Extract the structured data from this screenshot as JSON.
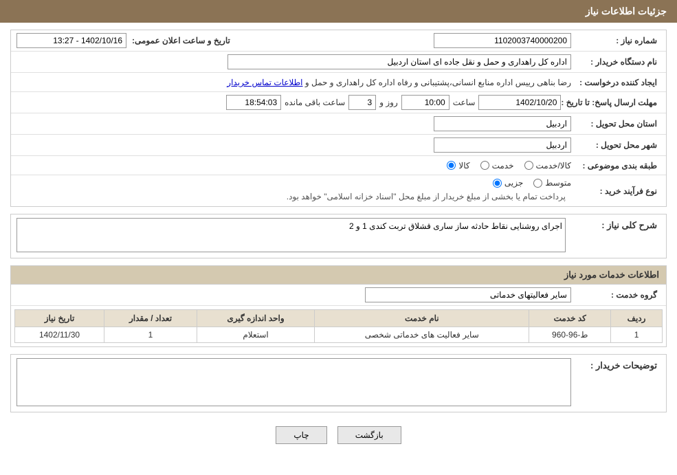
{
  "header": {
    "title": "جزئیات اطلاعات نیاز"
  },
  "fields": {
    "shomareNiaz_label": "شماره نیاز :",
    "shomareNiaz_value": "1102003740000200",
    "namDastgah_label": "نام دستگاه خریدار :",
    "namDastgah_value": "اداره کل راهداری و حمل و نقل جاده ای استان اردبیل",
    "ijadKonande_label": "ایجاد کننده درخواست :",
    "ijadKonande_value": "رضا بناهی رییس اداره منابع انسانی،پشتیبانی و رفاه اداره کل راهداری و حمل و",
    "ijadKonande_link": "اطلاعات تماس خریدار",
    "mohlat_label": "مهلت ارسال پاسخ: تا تاریخ :",
    "tarikh_value": "1402/10/20",
    "saat_label": "ساعت",
    "saat_value": "10:00",
    "rooz_label": "روز و",
    "rooz_value": "3",
    "baghimande_label": "ساعت باقی مانده",
    "baghimande_value": "18:54:03",
    "tarikh_sabt_label": "تاریخ و ساعت اعلان عمومی:",
    "tarikh_sabt_value": "1402/10/16 - 13:27",
    "ostan_label": "استان محل تحویل :",
    "ostan_value": "اردبیل",
    "shahr_label": "شهر محل تحویل :",
    "shahr_value": "اردبیل",
    "tabaghe_label": "طبقه بندی موضوعی :",
    "radio_kala": "کالا",
    "radio_khedmat": "خدمت",
    "radio_kala_khedmat": "کالا/خدمت",
    "noeFarayand_label": "نوع فرآیند خرید :",
    "radio_jozii": "جزیی",
    "radio_motavasset": "متوسط",
    "process_note": "پرداخت تمام یا بخشی از مبلغ خریدار از مبلغ محل \"اسناد خزانه اسلامی\" خواهد بود.",
    "sharh_label": "شرح کلی نیاز :",
    "sharh_value": "اجرای روشنایی نقاط حادثه ساز ساری قشلاق تربت کندی 1 و 2",
    "khedmat_section_title": "اطلاعات خدمات مورد نیاز",
    "grohe_khedmat_label": "گروه خدمت :",
    "grohe_khedmat_value": "سایر فعالیتهای خدماتی",
    "table": {
      "headers": [
        "ردیف",
        "کد خدمت",
        "نام خدمت",
        "واحد اندازه گیری",
        "تعداد / مقدار",
        "تاریخ نیاز"
      ],
      "rows": [
        {
          "radif": "1",
          "kod": "ط-96-960",
          "name": "سایر فعالیت های خدماتی شخصی",
          "vahed": "استعلام",
          "tedad": "1",
          "tarikh": "1402/11/30"
        }
      ]
    },
    "tozihat_label": "توضیحات خریدار :",
    "tozihat_value": ""
  },
  "buttons": {
    "print_label": "چاپ",
    "back_label": "بازگشت"
  }
}
